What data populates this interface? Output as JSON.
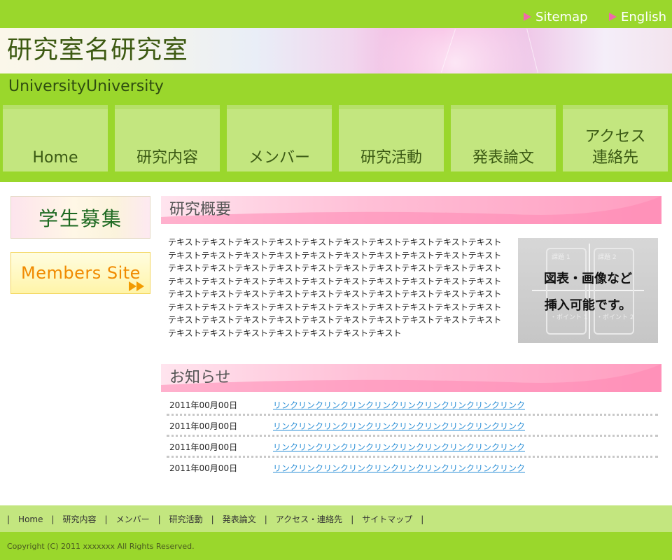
{
  "top_links": {
    "sitemap": "Sitemap",
    "english": "English"
  },
  "header": {
    "title": "研究室名研究室",
    "university": "UniversityUniversity"
  },
  "nav": [
    {
      "label": "Home"
    },
    {
      "label": "研究内容"
    },
    {
      "label": "メンバー"
    },
    {
      "label": "研究活動"
    },
    {
      "label": "発表論文"
    },
    {
      "label": "アクセス\n連絡先"
    }
  ],
  "sidebar": {
    "recruit": "学生募集",
    "members_site": "Members Site"
  },
  "overview": {
    "heading": "研究概要",
    "text": "テキストテキストテキストテキストテキストテキストテキストテキストテキストテキストテキストテキストテキストテキストテキストテキストテキストテキストテキストテキストテキストテキストテキストテキストテキストテキストテキストテキストテキストテキストテキストテキストテキストテキストテキストテキストテキストテキストテキストテキストテキストテキストテキストテキストテキストテキストテキストテキストテキストテキストテキストテキストテキストテキストテキストテキストテキストテキストテキストテキストテキストテキストテキストテキストテキストテキストテキストテキストテキストテキストテキストテキストテキストテキストテキストテキストテキスト",
    "image_caption_line1": "図表・画像など",
    "image_caption_line2": "挿入可能です。",
    "image_ghost_1": "課題 1",
    "image_ghost_2": "課題 2",
    "image_ghost_3": "・ポイント 1",
    "image_ghost_4": "・ポイント 2"
  },
  "news": {
    "heading": "お知らせ",
    "items": [
      {
        "date": "2011年00月00日",
        "link": "リンクリンクリンクリンクリンクリンクリンクリンクリンクリンク"
      },
      {
        "date": "2011年00月00日",
        "link": "リンクリンクリンクリンクリンクリンクリンクリンクリンクリンク"
      },
      {
        "date": "2011年00月00日",
        "link": "リンクリンクリンクリンクリンクリンクリンクリンクリンクリンク"
      },
      {
        "date": "2011年00月00日",
        "link": "リンクリンクリンクリンクリンクリンクリンクリンクリンクリンク"
      }
    ]
  },
  "footer_nav": [
    "Home",
    "研究内容",
    "メンバー",
    "研究活動",
    "発表論文",
    "アクセス・連絡先",
    "サイトマップ"
  ],
  "copyright": "Copyright (C) 2011 xxxxxxx All Rights Reserved.",
  "colors": {
    "green": "#9ad72c",
    "light_green": "#c3e67f",
    "pink": "#ff9dc0",
    "link": "#2b8fd6"
  }
}
